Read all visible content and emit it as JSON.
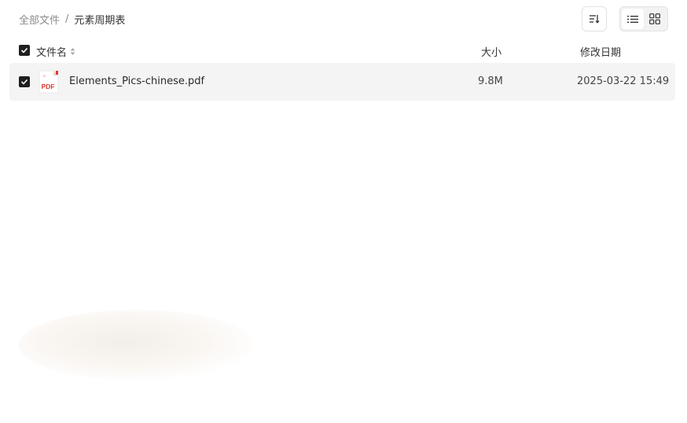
{
  "breadcrumb": {
    "root": "全部文件",
    "separator": "/",
    "current": "元素周期表"
  },
  "toolbar": {
    "sort_icon": "sort-icon",
    "list_view_icon": "list-view-icon",
    "grid_view_icon": "grid-view-icon",
    "active_view": "list"
  },
  "columns": {
    "name": "文件名",
    "size": "大小",
    "modified": "修改日期"
  },
  "files": [
    {
      "name": "Elements_Pics-chinese.pdf",
      "size": "9.8M",
      "modified": "2025-03-22 15:49",
      "type_label": "PDF",
      "checked": true
    }
  ],
  "colors": {
    "checkbox": "#1f1f1f",
    "row_bg": "#f4f4f4",
    "pdf_red": "#e53935",
    "muted_text": "#8a8a8a"
  }
}
